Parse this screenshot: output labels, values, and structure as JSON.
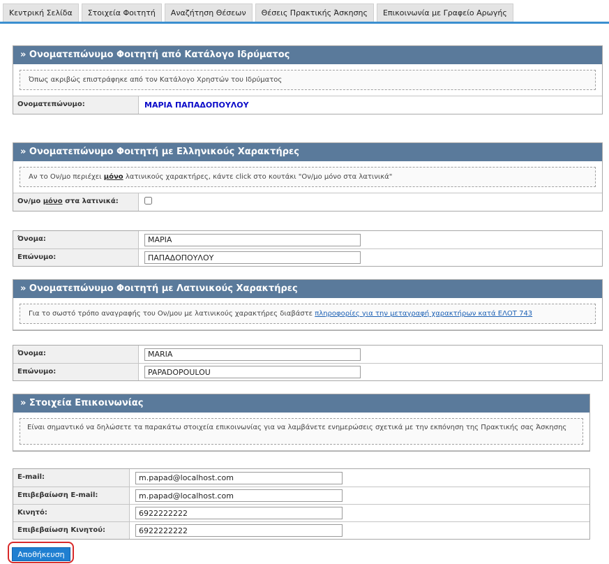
{
  "tabs": [
    "Κεντρική Σελίδα",
    "Στοιχεία Φοιτητή",
    "Αναζήτηση Θέσεων",
    "Θέσεις Πρακτικής Άσκησης",
    "Επικοινωνία με Γραφείο Αρωγής"
  ],
  "panel1": {
    "title": "» Ονοματεπώνυμο Φοιτητή από Κατάλογο Ιδρύματος",
    "note": "Όπως ακριβώς επιστράφηκε από τον Κατάλογο Χρηστών του Ιδρύματος",
    "label": "Ονοματεπώνυμο:",
    "value": "ΜΑΡΙΑ ΠΑΠΑΔΟΠΟΥΛΟΥ"
  },
  "panel2": {
    "title": "» Ονοματεπώνυμο Φοιτητή με Ελληνικούς Χαρακτήρες",
    "note_pre": "Αν το Ον/μο περιέχει ",
    "note_bold": "μόνο",
    "note_post": " λατινικούς χαρακτήρες, κάντε click στο κουτάκι \"Ον/μο μόνο στα λατινικά\"",
    "latin_label_pre": "Ον/μο ",
    "latin_label_u": "μόνο",
    "latin_label_post": " στα λατινικά:",
    "latin_only_checked": false,
    "first_label": "Όνομα:",
    "first_value": "ΜΑΡΙΑ",
    "last_label": "Επώνυμο:",
    "last_value": "ΠΑΠΑΔΟΠΟΥΛΟΥ"
  },
  "panel3": {
    "title": "» Ονοματεπώνυμο Φοιτητή με Λατινικούς Χαρακτήρες",
    "note_pre": "Για το σωστό τρόπο αναγραφής του Ον/μου με λατινικούς χαρακτήρες διαβάστε ",
    "note_link": "πληροφορίες για την μεταγραφή χαρακτήρων κατά ΕΛΟΤ 743",
    "first_label": "Όνομα:",
    "first_value": "MARIA",
    "last_label": "Επώνυμο:",
    "last_value": "PAPADOPOULOU"
  },
  "panel4": {
    "title": "» Στοιχεία Επικοινωνίας",
    "note": "Είναι σημαντικό να δηλώσετε τα παρακάτω στοιχεία επικοινωνίας για να λαμβάνετε ενημερώσεις σχετικά με την εκπόνηση της Πρακτικής σας Άσκησης",
    "email_label": "E-mail:",
    "email_value": "m.papad@localhost.com",
    "email_confirm_label": "Επιβεβαίωση E-mail:",
    "email_confirm_value": "m.papad@localhost.com",
    "mobile_label": "Κινητό:",
    "mobile_value": "6922222222",
    "mobile_confirm_label": "Επιβεβαίωση Κινητού:",
    "mobile_confirm_value": "6922222222"
  },
  "save_button": "Αποθήκευση",
  "colors": {
    "panel_header": "#5a7a9b",
    "tab_underline": "#3b8fd0",
    "save_button": "#1f7fd1",
    "highlight_outline": "#d82a2a"
  }
}
